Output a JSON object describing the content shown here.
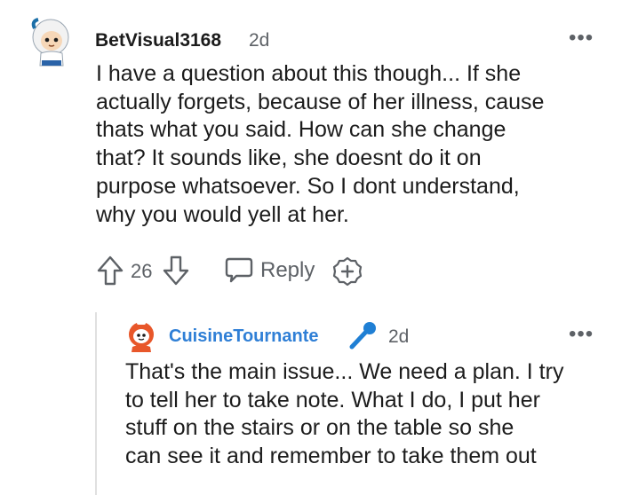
{
  "comment": {
    "username": "BetVisual3168",
    "time": "2d",
    "more": "•••",
    "body_lines": [
      "I have a question about this though... If she",
      "actually forgets, because of her illness, cause",
      "thats what you said. How can she change",
      "that? It sounds like, she doesnt do it on",
      "purpose whatsoever. So I dont understand,",
      "why you would yell at her."
    ],
    "actions": {
      "score": "26",
      "reply_label": "Reply",
      "upvote_icon": "upvote-arrow-icon",
      "downvote_icon": "downvote-arrow-icon",
      "reply_icon": "speech-bubble-icon",
      "award_icon": "plus-award-icon"
    }
  },
  "reply": {
    "username": "CuisineTournante",
    "username_color": "#2f7fd6",
    "badge_icon": "microphone-icon",
    "time": "2d",
    "more": "•••",
    "body_lines": [
      "That's the main issue... We need a plan. I try",
      "to tell her to take note. What I do, I put her",
      "stuff on the stairs or on the table so she",
      "can see it and remember to take them out"
    ]
  }
}
